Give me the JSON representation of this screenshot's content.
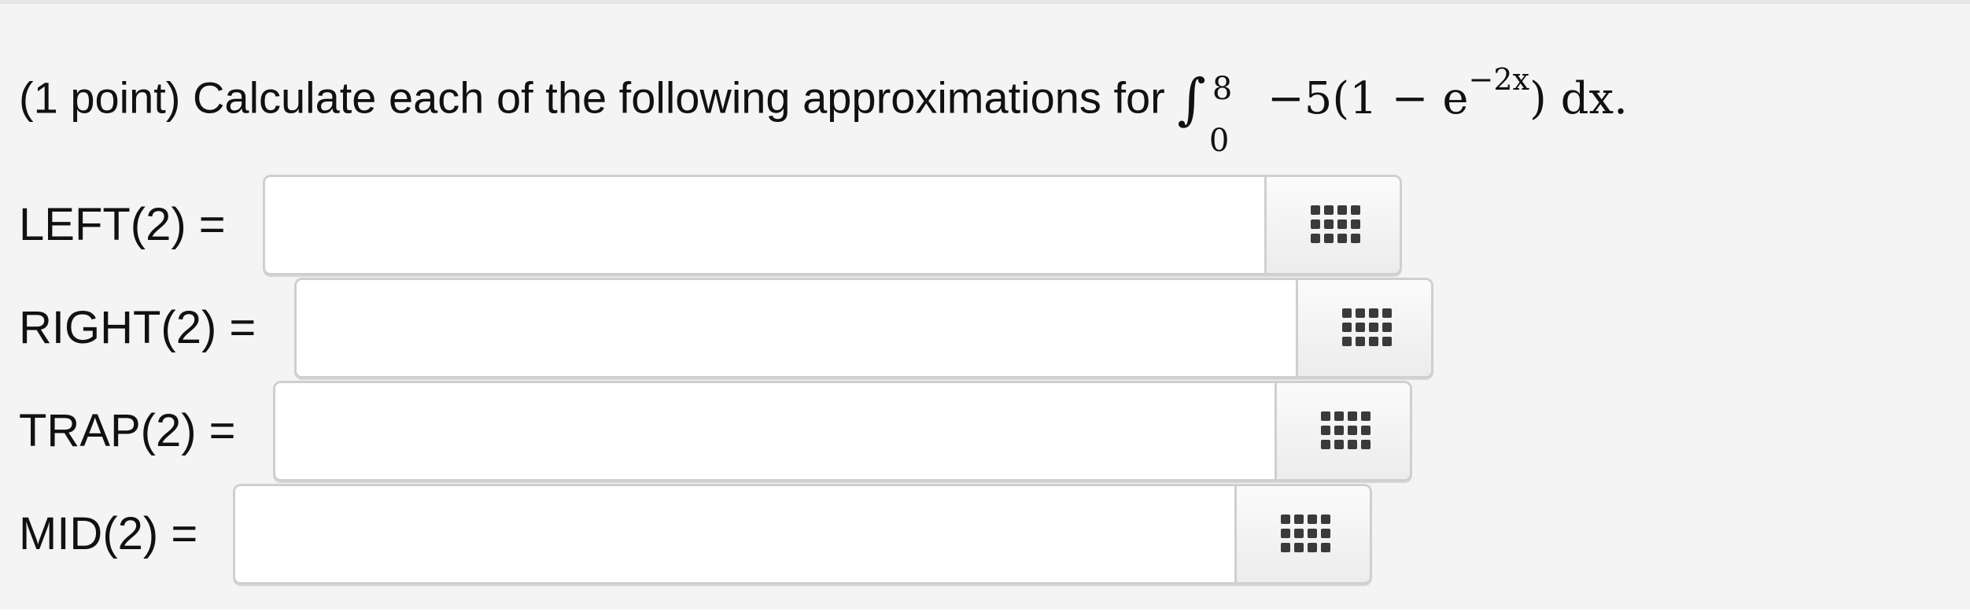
{
  "question": {
    "prefix": "(1 point) Calculate each of the following approximations for",
    "integral_symbol": "∫",
    "upper_limit": "8",
    "lower_limit": "0",
    "integrand_part1": "−5(1 − e",
    "exponent": "−2x",
    "integrand_part2": ") dx."
  },
  "answers": [
    {
      "label": "LEFT(2) =",
      "value": ""
    },
    {
      "label": "RIGHT(2) =",
      "value": ""
    },
    {
      "label": "TRAP(2) =",
      "value": ""
    },
    {
      "label": "MID(2) =",
      "value": ""
    }
  ],
  "icons": {
    "keypad": "keypad-grid-icon"
  },
  "colors": {
    "background": "#f4f4f4",
    "box_border": "#cfcfcf",
    "icon": "#3a3a3a"
  }
}
